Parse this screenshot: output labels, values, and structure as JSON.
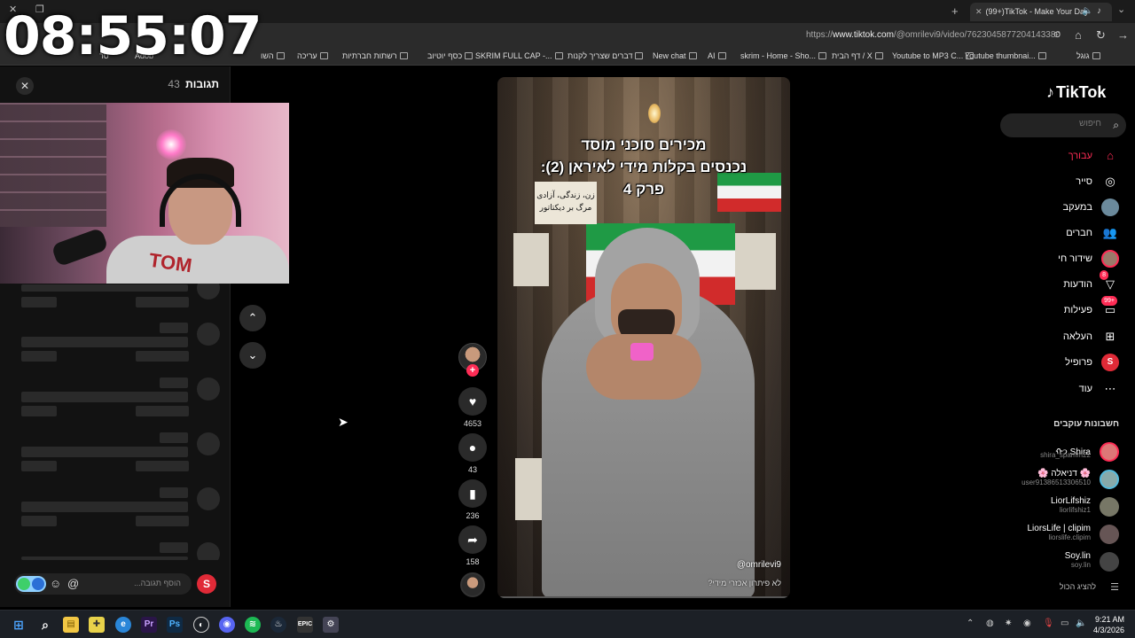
{
  "overlay": {
    "clock": "08:55:07"
  },
  "browser": {
    "active_tab_title": "(99+)TikTok - Make Your Day",
    "url_prefix": "https://",
    "url_host": "www.tiktok.com",
    "url_path": "/@omrilevi9/video/7623045877204143380",
    "bookmarks": [
      "גוגל",
      "Youtube thumbnai...",
      "Youtube to MP3 C...",
      "דף הבית / X",
      "skrim - Home - Sho...",
      "AI",
      "New chat",
      "דברים שצריך לקנות",
      "SKRIM FULL CAP -...",
      "כסף יוטיוב",
      "רשתות חברתיות",
      "עריכה"
    ],
    "bookmarks_partial": [
      "השו",
      "Adob",
      "סר"
    ]
  },
  "comments": {
    "title": "תגובות",
    "count": "43",
    "input_placeholder": "הוסף תגובה..."
  },
  "video": {
    "caption_line1": "מכירים סוכני מוסד",
    "caption_line2": "נכנסים בקלות מידי לאיראן (2):",
    "caption_line3": "פרק 4",
    "sign_line1": "زن، زندگی، آزادی",
    "sign_line2": "مرگ بر دیکتاتور",
    "author": "@omrilevi9",
    "description": "לא פיתרון אכזרי מידי?"
  },
  "actions": {
    "likes": "4653",
    "comments": "43",
    "saves": "236",
    "shares": "158"
  },
  "sidebar": {
    "logo": "TikTok",
    "search_placeholder": "חיפוש",
    "items": [
      {
        "label": "עבורך",
        "icon": "home-icon"
      },
      {
        "label": "סייר",
        "icon": "compass-icon"
      },
      {
        "label": "במעקב",
        "icon": "following-avatar-icon"
      },
      {
        "label": "חברים",
        "icon": "friends-icon"
      },
      {
        "label": "שידור חי",
        "icon": "live-icon"
      },
      {
        "label": "הודעות",
        "icon": "messages-icon",
        "badge": "8"
      },
      {
        "label": "פעילות",
        "icon": "activity-icon",
        "badge": "99+"
      },
      {
        "label": "העלאה",
        "icon": "upload-icon"
      },
      {
        "label": "פרופיל",
        "icon": "profile-icon"
      },
      {
        "label": "עוד",
        "icon": "more-icon"
      }
    ],
    "following_title": "חשבונות עוקבים",
    "accounts": [
      {
        "name": "ᡣ𐭩 Shira",
        "handle": "shira_spamm22"
      },
      {
        "name": "🌸 דניאלה 🌸",
        "handle": "user91386513306510"
      },
      {
        "name": "LiorLifshiz",
        "handle": "liorlifshiz1"
      },
      {
        "name": "LiorsLife | clipim",
        "handle": "liorslife.clipim"
      },
      {
        "name": "Soy.lin",
        "handle": "soy.lin"
      }
    ],
    "show_all": "להציג הכול"
  },
  "taskbar": {
    "time": "9:21 AM",
    "date": "4/3/2026"
  }
}
